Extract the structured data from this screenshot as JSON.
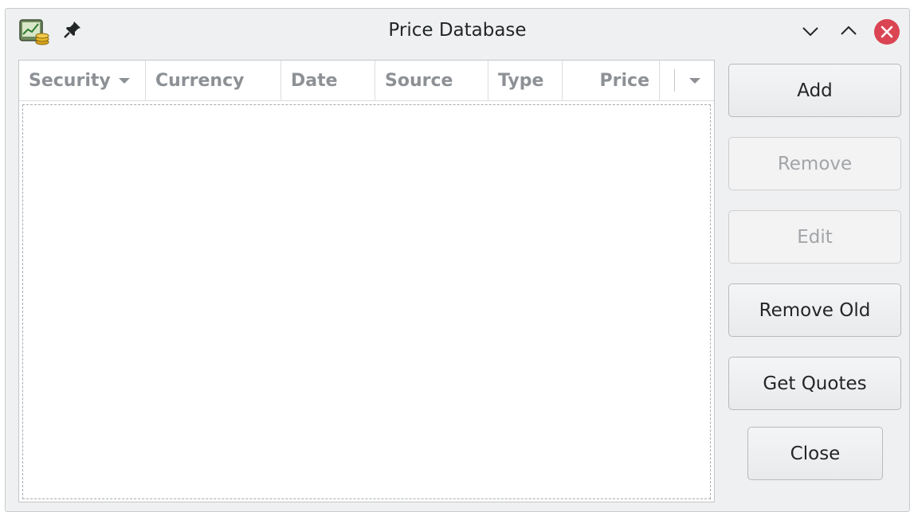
{
  "window": {
    "title": "Price Database"
  },
  "table": {
    "columns": [
      {
        "label": "Security",
        "sorted": true
      },
      {
        "label": "Currency"
      },
      {
        "label": "Date"
      },
      {
        "label": "Source"
      },
      {
        "label": "Type"
      },
      {
        "label": "Price"
      }
    ],
    "rows": []
  },
  "buttons": {
    "add": "Add",
    "remove": "Remove",
    "edit": "Edit",
    "remove_old": "Remove Old",
    "get_quotes": "Get Quotes",
    "close": "Close"
  },
  "icons": {
    "app": "price-database-app-icon",
    "pin": "pin-icon",
    "minimize": "chevron-down-icon",
    "maximize": "chevron-up-icon",
    "close": "close-icon"
  },
  "colors": {
    "close_button": "#da4453",
    "header_text": "#8d9195",
    "disabled_text": "#a2a5a8"
  }
}
